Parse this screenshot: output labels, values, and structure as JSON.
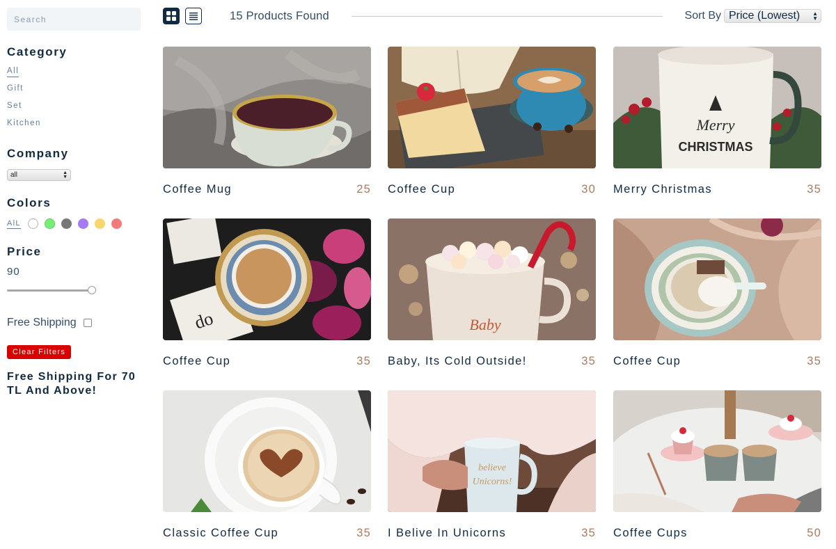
{
  "search": {
    "placeholder": "Search"
  },
  "filters": {
    "category_title": "Category",
    "categories": [
      "All",
      "Gift",
      "Set",
      "Kitchen"
    ],
    "company_title": "Company",
    "company_selected": "all",
    "colors_title": "Colors",
    "colors_all_label": "AlL",
    "colors": [
      "#ffffff",
      "#77ef77",
      "#777777",
      "#a57bf6",
      "#f9d56d",
      "#f57b7b"
    ],
    "price_title": "Price",
    "price_value": "90",
    "price_slider_fraction": 1.0,
    "free_shipping_label": "Free Shipping",
    "free_shipping_checked": false,
    "clear_label": "Clear Filters",
    "promo_text": "Free Shipping For 70 TL And Above!"
  },
  "header": {
    "grid_view_icon": "grid-icon",
    "list_view_icon": "list-icon",
    "found_text": "15 Products Found",
    "sort_label": "Sort By",
    "sort_selected": "Price (Lowest)"
  },
  "products": [
    {
      "name": "Coffee Mug",
      "price": "25",
      "image": "tea-cup-gray-blanket"
    },
    {
      "name": "Coffee Cup",
      "price": "30",
      "image": "latte-book-cheesecake"
    },
    {
      "name": "Merry Christmas",
      "price": "35",
      "image": "merry-christmas-mug"
    },
    {
      "name": "Coffee Cup",
      "price": "35",
      "image": "floral-cup-tulips"
    },
    {
      "name": "Baby, Its Cold Outside!",
      "price": "35",
      "image": "marshmallow-mug-candy-cane"
    },
    {
      "name": "Coffee Cup",
      "price": "35",
      "image": "floral-cup-satin"
    },
    {
      "name": "Classic Coffee Cup",
      "price": "35",
      "image": "heart-cappuccino"
    },
    {
      "name": "I Belive In Unicorns",
      "price": "35",
      "image": "unicorn-mug-hands"
    },
    {
      "name": "Coffee Cups",
      "price": "50",
      "image": "cupcakes-lattes-table"
    }
  ],
  "colors": {
    "accent_price": "#ab7a5f",
    "clear_button": "#d90000",
    "heading": "#102a42"
  }
}
